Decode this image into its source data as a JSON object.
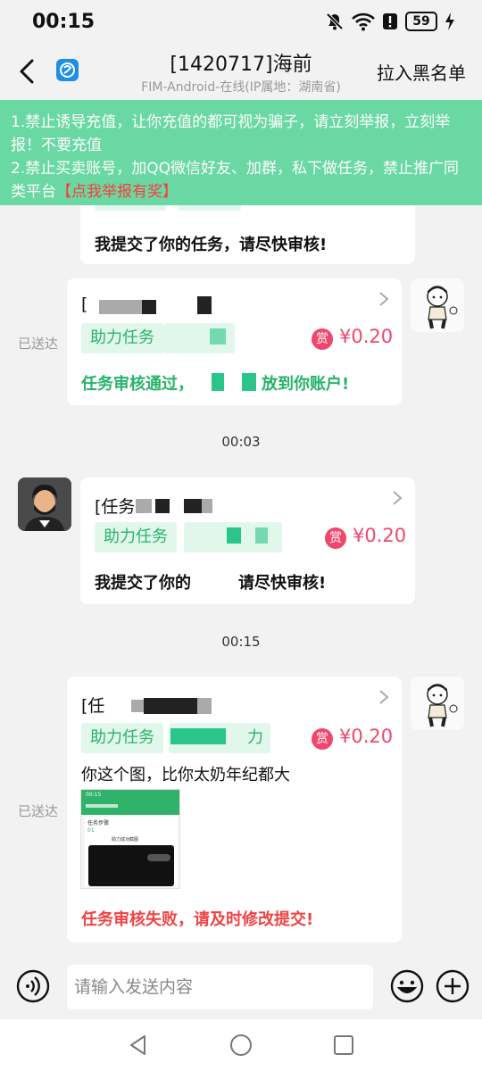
{
  "status_bar": {
    "time": "00:15",
    "battery": "59",
    "icons": [
      "bell-muted-icon",
      "wifi-icon",
      "alert-icon",
      "battery-icon",
      "charging-icon"
    ]
  },
  "header": {
    "title": "[1420717]海前",
    "subtitle": "FIM-Android-在线(IP属地：湖南省)",
    "blacklist_label": "拉入黑名单",
    "back_icon": "back-arrow-icon",
    "logo_icon": "app-logo-icon"
  },
  "notice": {
    "line1": "1.禁止诱导充值，让你充值的都可视为骗子，请立刻举报，立刻举报！不要充值",
    "line2_prefix": "2.禁止买卖账号，加QQ微信好友、加群，私下做任务，禁止推广同类平台",
    "report_link": "【点我举报有奖】"
  },
  "messages": {
    "m0": {
      "text": "我提交了你的任务，请尽快审核!"
    },
    "m1": {
      "title_prefix": "[",
      "tag": "助力任务",
      "badge": "赏",
      "amount": "¥0.20",
      "text": "任务审核通过，",
      "text_suffix": "放到你账户!",
      "sent": "已送达"
    },
    "time1": "00:03",
    "m2": {
      "title_prefix": "[任务",
      "tag": "助力任务",
      "badge": "赏",
      "amount": "¥0.20",
      "text": "我提交了你的",
      "text_suffix": "请尽快审核!"
    },
    "time2": "00:15",
    "m3": {
      "title_prefix": "[任",
      "tag": "助力任务",
      "tag2_suffix": "力",
      "badge": "赏",
      "amount": "¥0.20",
      "comment": "你这个图，比你太奶年纪都大",
      "fail_text": "任务审核失败，请及时修改提交!",
      "sent": "已送达"
    }
  },
  "thumbnail": {
    "time": "00:15",
    "title": "任务步骤",
    "step": "01",
    "caption": "助力成功截图"
  },
  "input": {
    "placeholder": "请输入发送内容"
  },
  "colors": {
    "notice_bg": "#6ad8a2",
    "accent_green": "#27b36a",
    "reward_pink": "#f0466e",
    "error_red": "#f04343"
  }
}
